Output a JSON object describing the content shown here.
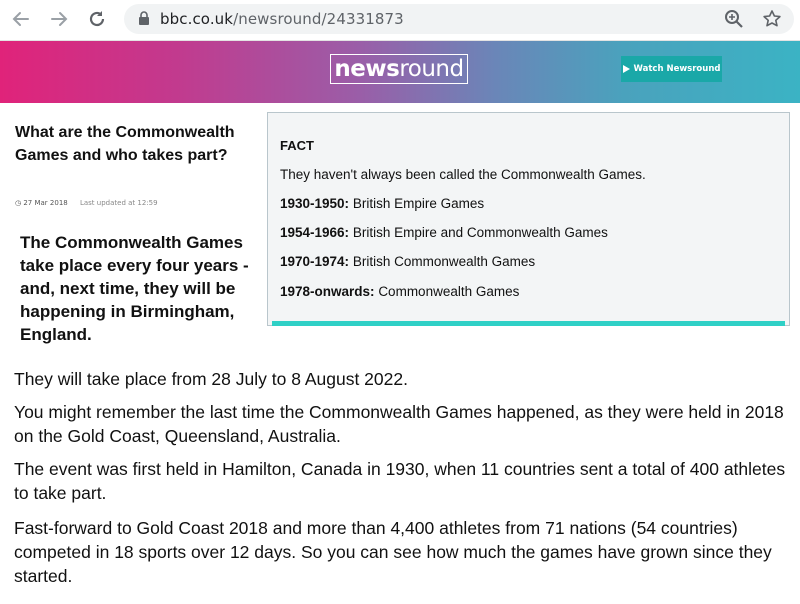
{
  "browser": {
    "url_host": "bbc.co.uk",
    "url_path": "/newsround/24331873"
  },
  "banner": {
    "logo_bold": "news",
    "logo_light": "round",
    "watch_label": "Watch Newsround"
  },
  "article": {
    "title": "What are the Commonwealth Games and who takes part?",
    "date": "27 Mar 2018",
    "updated": "Last updated at 12:59",
    "intro": "The Commonwealth Games take place every four years - and, next time, they will be happening in Birmingham, England."
  },
  "fact": {
    "heading": "FACT",
    "lead": "They haven't always been called the Commonwealth Games.",
    "items": [
      {
        "years": "1930-1950:",
        "name": "British Empire Games"
      },
      {
        "years": "1954-1966:",
        "name": "British Empire and Commonwealth Games"
      },
      {
        "years": "1970-1974:",
        "name": "British Commonwealth Games"
      },
      {
        "years": "1978-onwards:",
        "name": "Commonwealth Games"
      }
    ]
  },
  "paragraphs": [
    "They will take place from 28 July to 8 August 2022.",
    "You might remember the last time the Commonwealth Games happened, as they were held in 2018 on the Gold Coast, Queensland, Australia.",
    "The event was first held in Hamilton, Canada in 1930, when 11 countries sent a total of 400 athletes to take part.",
    "Fast-forward to Gold Coast 2018 and more than 4,400 athletes from 71 nations (54 countries) competed in 18 sports over 12 days. So you can see how much the games have grown since they started."
  ],
  "colors": {
    "accent": "#2fd0c6",
    "watch_button": "#1aa8a8"
  }
}
